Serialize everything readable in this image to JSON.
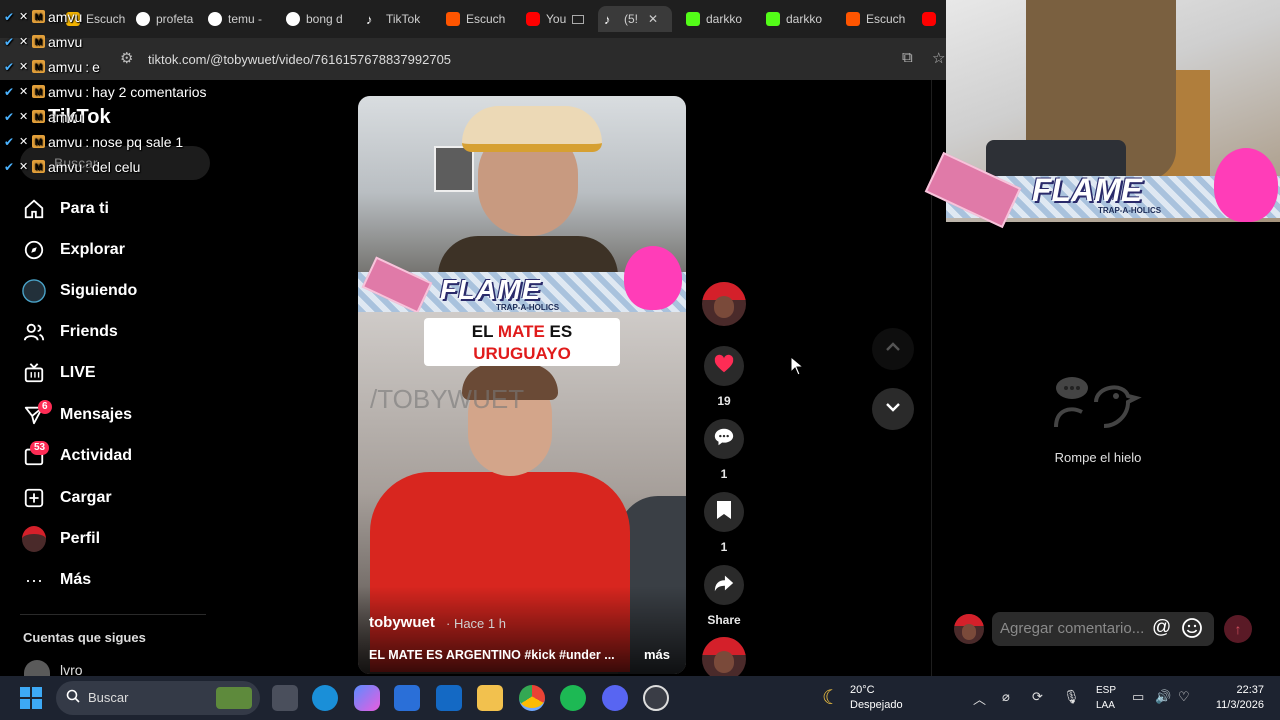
{
  "colors": {
    "accent": "#fe2c55",
    "background": "#000000",
    "chrome": "#1f1f1f",
    "taskbar": "#1d2330"
  },
  "browser": {
    "tabs": [
      {
        "label": "Escuch",
        "icon": "escuchar-favicon",
        "color": "#f4b400"
      },
      {
        "label": "profeta",
        "icon": "google-icon",
        "color": "#4285f4"
      },
      {
        "label": "temu -",
        "icon": "google-icon",
        "color": "#4285f4"
      },
      {
        "label": "bong d",
        "icon": "google-icon",
        "color": "#4285f4"
      },
      {
        "label": "TikTok",
        "icon": "tiktok-icon",
        "color": "#ffffff"
      },
      {
        "label": "Escuch",
        "icon": "soundcloud-icon",
        "color": "#ff5500"
      },
      {
        "label": "You",
        "icon": "youtube-icon",
        "color": "#ff0000"
      },
      {
        "label": "(5!",
        "icon": "tiktok-icon",
        "color": "#ffffff"
      },
      {
        "label": "darkko",
        "icon": "kick-icon",
        "color": "#53fc18"
      },
      {
        "label": "darkko",
        "icon": "kick-icon",
        "color": "#53fc18"
      },
      {
        "label": "Escuch",
        "icon": "soundcloud-icon",
        "color": "#ff5500"
      }
    ],
    "url": "tiktok.com/@tobywuet/video/7616157678837992705"
  },
  "chat": {
    "messages": [
      {
        "user": "amvu",
        "text": ""
      },
      {
        "user": "amvu",
        "text": ""
      },
      {
        "user": "amvu",
        "text": "e"
      },
      {
        "user": "amvu",
        "text": "hay 2 comentarios"
      },
      {
        "user": "amvu",
        "text": ""
      },
      {
        "user": "amvu",
        "text": "nose pq sale 1"
      },
      {
        "user": "amvu",
        "text": "del celu"
      }
    ]
  },
  "sidebar": {
    "logo": "TikTok",
    "search_placeholder": "Buscar",
    "items": [
      {
        "label": "Para ti",
        "icon": "home-icon"
      },
      {
        "label": "Explorar",
        "icon": "compass-icon"
      },
      {
        "label": "Siguiendo",
        "icon": "following-icon"
      },
      {
        "label": "Friends",
        "icon": "friends-icon"
      },
      {
        "label": "LIVE",
        "icon": "live-icon"
      },
      {
        "label": "Mensajes",
        "icon": "messages-icon",
        "badge": "6"
      },
      {
        "label": "Actividad",
        "icon": "activity-icon",
        "badge": "53"
      },
      {
        "label": "Cargar",
        "icon": "upload-icon"
      },
      {
        "label": "Perfil",
        "icon": "profile-avatar-icon"
      },
      {
        "label": "Más",
        "icon": "more-icon"
      }
    ],
    "following_heading": "Cuentas que sigues",
    "following": [
      {
        "name": "lvro"
      }
    ]
  },
  "video": {
    "flame_title": "FLAME",
    "flame_subtitle": "TRAP-A-HOLICS",
    "caption_parts": [
      "EL ",
      "MATE",
      " ES",
      "URUGUAYO"
    ],
    "watermark": "/TOBYWUET",
    "author": "tobywuet",
    "time_ago": "· Hace 1 h",
    "description": "EL MATE ES ARGENTINO #kick #under ...",
    "more": "más"
  },
  "actions": {
    "likes": "19",
    "comments": "1",
    "saves": "1",
    "share": "Share"
  },
  "comments_pane": {
    "empty_text": "Rompe el hielo",
    "input_placeholder": "Agregar comentario..."
  },
  "taskbar": {
    "search": "Buscar",
    "weather_temp": "20°C",
    "weather_desc": "Despejado",
    "lang_line1": "ESP",
    "lang_line2": "LAA",
    "time": "22:37",
    "date": "11/3/2026"
  }
}
